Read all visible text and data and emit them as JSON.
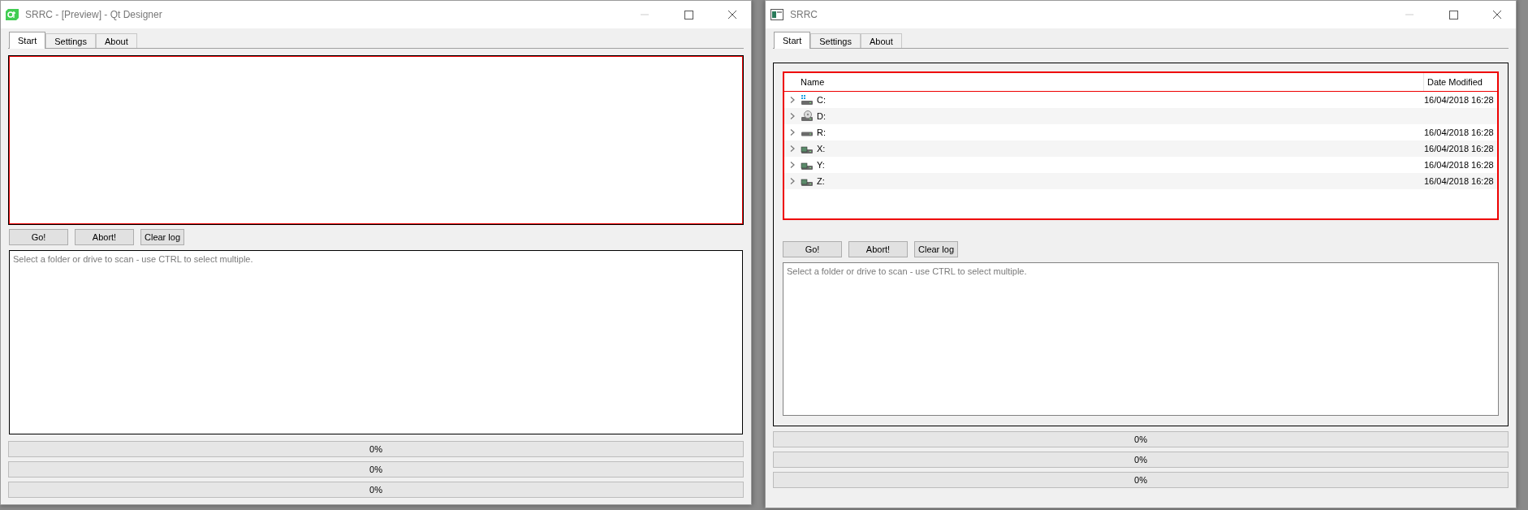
{
  "windows": [
    {
      "kind": "preview",
      "title": "SRRC - [Preview] - Qt Designer",
      "tabs": [
        {
          "label": "Start",
          "selected": true
        },
        {
          "label": "Settings",
          "selected": false
        },
        {
          "label": "About",
          "selected": false
        }
      ],
      "buttons": [
        {
          "label": "Go!",
          "kind": "wide"
        },
        {
          "label": "Abort!",
          "kind": "wide"
        },
        {
          "label": "Clear log",
          "kind": "compact"
        }
      ],
      "log": {
        "placeholder": "Select a folder or drive to scan - use CTRL to select multiple."
      },
      "progress": [
        {
          "label": "0%",
          "level": 0
        },
        {
          "label": "0%",
          "level": 0
        },
        {
          "label": "0%",
          "level": 0
        }
      ]
    },
    {
      "kind": "app",
      "title": "SRRC",
      "tabs": [
        {
          "label": "Start",
          "selected": true
        },
        {
          "label": "Settings",
          "selected": false
        },
        {
          "label": "About",
          "selected": false
        }
      ],
      "tree": {
        "columns": [
          "Name",
          "Date Modified"
        ],
        "rows": [
          {
            "name": "C:",
            "date": "16/04/2018 16:28",
            "kind": "system"
          },
          {
            "name": "D:",
            "kind": "optical"
          },
          {
            "name": "R:",
            "date": "16/04/2018 16:28",
            "kind": "drive"
          },
          {
            "name": "X:",
            "date": "16/04/2018 16:28",
            "kind": "network"
          },
          {
            "name": "Y:",
            "date": "16/04/2018 16:28",
            "kind": "network"
          },
          {
            "name": "Z:",
            "date": "16/04/2018 16:28",
            "kind": "network"
          }
        ]
      },
      "buttons": [
        {
          "label": "Go!",
          "kind": "wide"
        },
        {
          "label": "Abort!",
          "kind": "wide"
        },
        {
          "label": "Clear log",
          "kind": "compact"
        }
      ],
      "log": {
        "placeholder": "Select a folder or drive to scan - use CTRL to select multiple."
      },
      "progress": [
        {
          "label": "0%",
          "level": 0
        },
        {
          "label": "0%",
          "level": 0
        },
        {
          "label": "0%",
          "level": 0
        }
      ]
    }
  ]
}
